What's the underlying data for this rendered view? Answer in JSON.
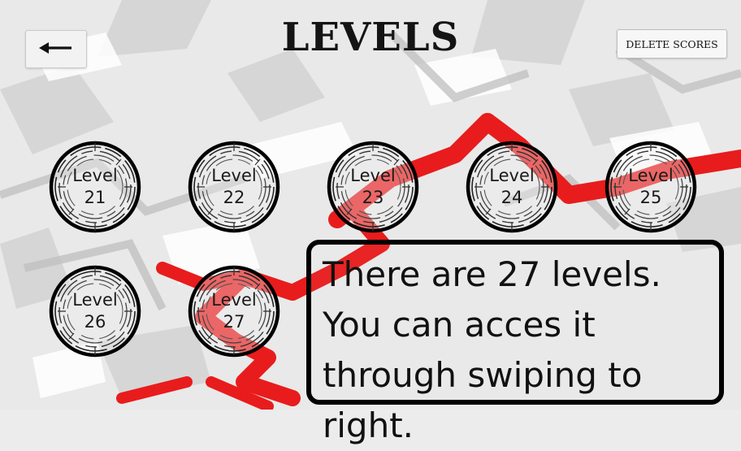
{
  "title": "LEVELS",
  "back_button": {
    "icon": "arrow-left-icon"
  },
  "delete_button": {
    "label": "DELETE SCORES"
  },
  "levels": [
    {
      "word": "Level",
      "number": "21"
    },
    {
      "word": "Level",
      "number": "22"
    },
    {
      "word": "Level",
      "number": "23"
    },
    {
      "word": "Level",
      "number": "24"
    },
    {
      "word": "Level",
      "number": "25"
    },
    {
      "word": "Level",
      "number": "26"
    },
    {
      "word": "Level",
      "number": "27"
    }
  ],
  "info_text": "There are 27 levels. You can  acces it through swiping to right.",
  "colors": {
    "accent_red": "#e81c1c",
    "ink": "#111111"
  }
}
